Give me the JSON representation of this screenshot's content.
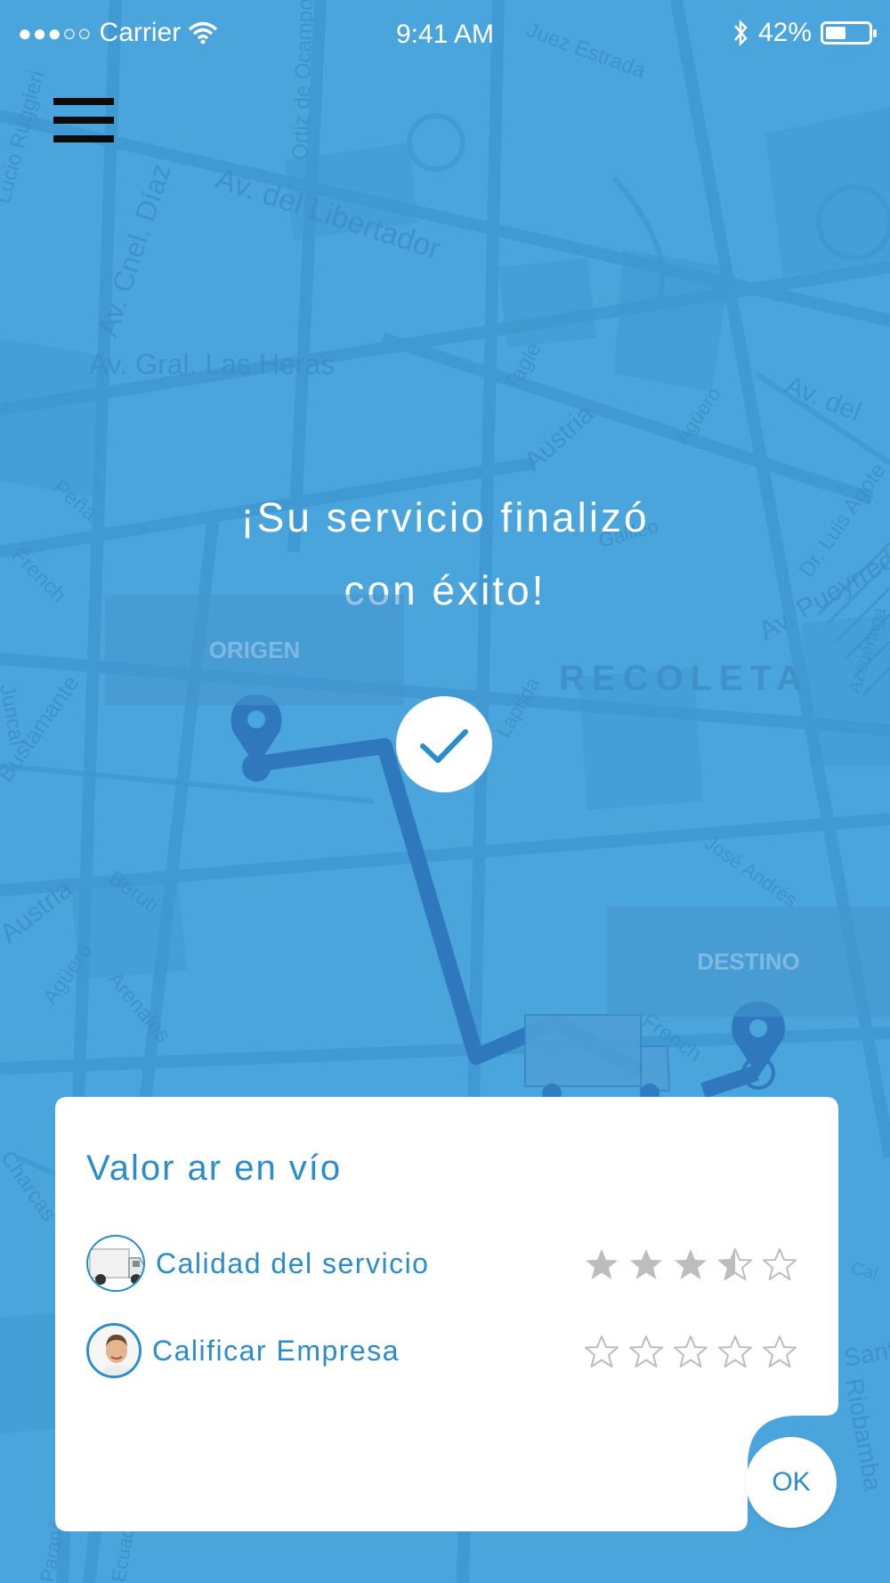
{
  "status_bar": {
    "signal_dots": "●●●○○",
    "carrier": "Carrier",
    "time": "9:41 AM",
    "battery_text": "42%",
    "battery_level": 0.42
  },
  "map": {
    "streets": [
      "Av. del Libertador",
      "Av. Cnel. Díaz",
      "Ortiz de Ocampo",
      "Juez Estrada",
      "Av. Gral. Las Heras",
      "Tagle",
      "Austria",
      "Agüero",
      "Av. del",
      "Peña",
      "French",
      "Galileo",
      "Dr. Luis Agote",
      "Av. Pueyrredón",
      "Azcuénaga",
      "RECOLETA",
      "Laprida",
      "José Andrés",
      "Austria",
      "Beruti",
      "Agüero",
      "Arenales",
      "French",
      "Bustamante",
      "Charcas",
      "Riobamba",
      "Juncal",
      "Lucio Ruggieri",
      "Cal",
      "Santa Fe",
      "Paraná",
      "Ecuador"
    ],
    "origin_label": "ORIGEN",
    "destination_label": "DESTINO"
  },
  "headline": {
    "line1": "¡Su servicio finalizó",
    "line2": "con éxito!"
  },
  "rating_card": {
    "title": "Valor ar en vío",
    "rows": [
      {
        "label": "Calidad del   servicio",
        "rating": 3.5,
        "max": 5
      },
      {
        "label": "Calificar  Empresa",
        "rating": 0,
        "max": 5
      }
    ],
    "ok_label": "OK"
  },
  "colors": {
    "background": "#4aa5dc",
    "route": "#2f78be",
    "accent": "#2a8ccc",
    "star": "#bdbdbd"
  }
}
